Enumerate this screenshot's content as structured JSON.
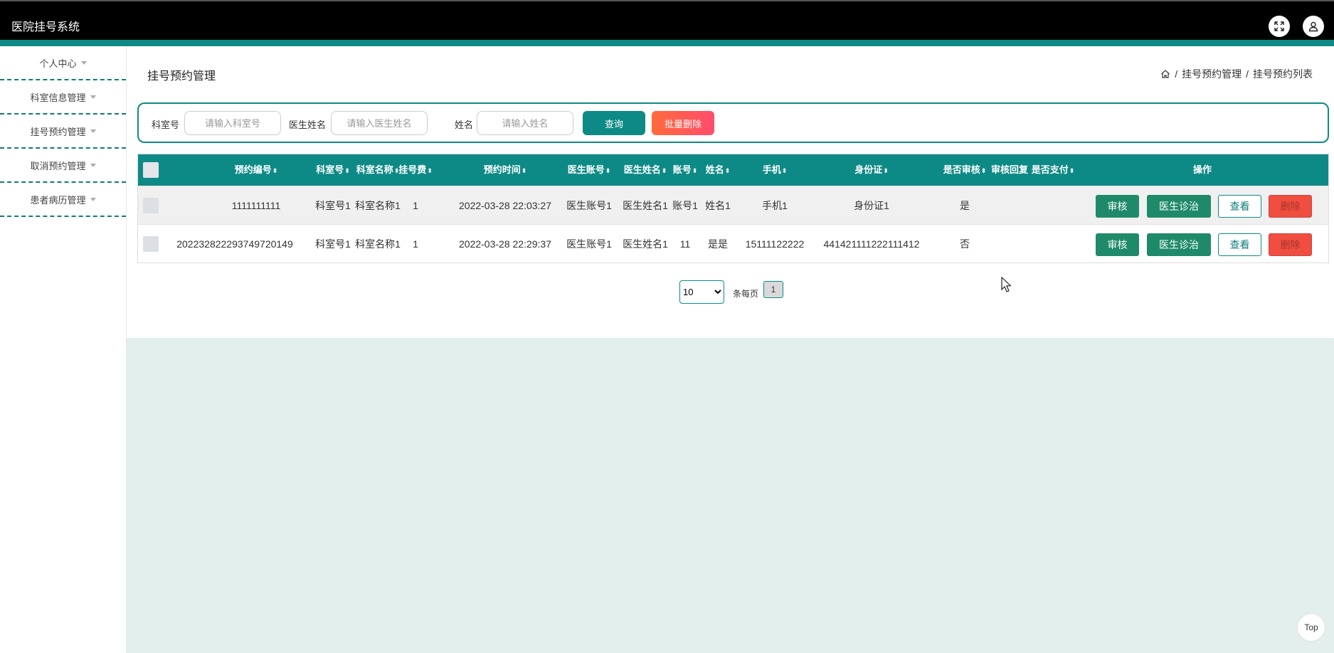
{
  "header": {
    "title": "医院挂号系统"
  },
  "sidebar": {
    "items": [
      {
        "label": "个人中心"
      },
      {
        "label": "科室信息管理"
      },
      {
        "label": "挂号预约管理"
      },
      {
        "label": "取消预约管理"
      },
      {
        "label": "患者病历管理"
      }
    ]
  },
  "page": {
    "title": "挂号预约管理",
    "breadcrumb": [
      "挂号预约管理",
      "挂号预约列表"
    ],
    "breadcrumb_sep": "/"
  },
  "search": {
    "dept_label": "科室号",
    "dept_placeholder": "请输入科室号",
    "doctor_label": "医生姓名",
    "doctor_placeholder": "请输入医生姓名",
    "name_label": "姓名",
    "name_placeholder": "请输入姓名",
    "query_label": "查询",
    "batch_delete_label": "批量删除"
  },
  "table": {
    "columns": [
      "预约编号",
      "科室号",
      "科室名称",
      "挂号费",
      "预约时间",
      "医生账号",
      "医生姓名",
      "账号",
      "姓名",
      "手机",
      "身份证",
      "是否审核",
      "审核回复",
      "是否支付",
      "操作"
    ],
    "sort_glyph": "⬍",
    "rows": [
      [
        "1111111111",
        "科室号1",
        "科室名称1",
        "1",
        "2022-03-28 22:03:27",
        "医生账号1",
        "医生姓名1",
        "账号1",
        "姓名1",
        "手机1",
        "身份证1",
        "是",
        "",
        ""
      ],
      [
        "202232822293749720149",
        "科室号1",
        "科室名称1",
        "1",
        "2022-03-28 22:29:37",
        "医生账号1",
        "医生姓名1",
        "11",
        "是是",
        "15111122222",
        "441421111222111412",
        "否",
        "",
        ""
      ]
    ],
    "actions": {
      "audit": "审核",
      "diagnose": "医生诊治",
      "view": "查看",
      "delete": "删除"
    }
  },
  "pagination": {
    "page_size": "10",
    "page_size_options": [
      "10"
    ],
    "per_page_label": "条每页",
    "current_page": "1"
  },
  "back_to_top": "Top",
  "colors": {
    "accent": "#0e8a86",
    "danger": "#f04e3e",
    "header_bg": "#000000"
  },
  "icons": [
    "fullscreen-icon",
    "user-icon",
    "home-icon",
    "caret-down-icon",
    "sort-icon",
    "cursor-icon"
  ]
}
